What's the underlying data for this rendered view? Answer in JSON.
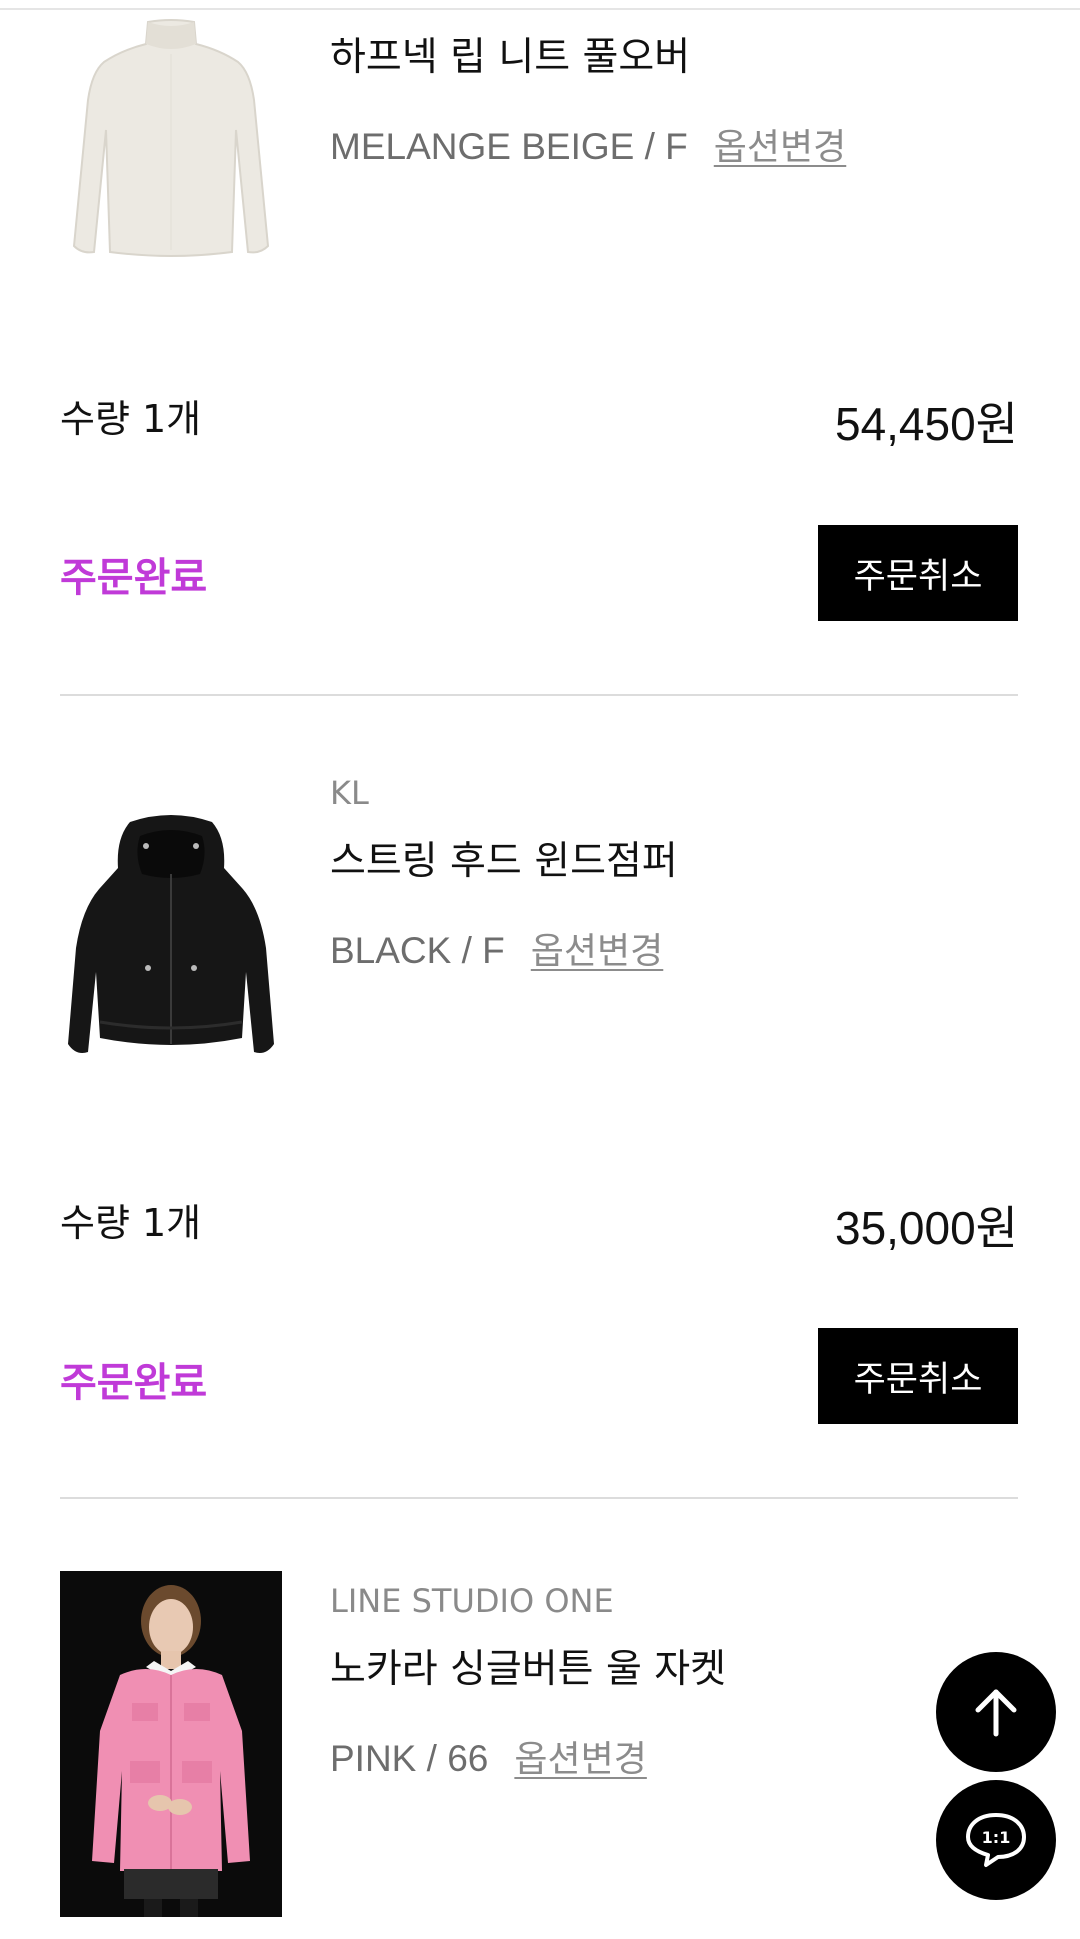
{
  "items": [
    {
      "brand": "",
      "name": "하프넥 립 니트 풀오버",
      "option": "MELANGE BEIGE / F",
      "option_change": "옵션변경",
      "quantity": "수량 1개",
      "price": "54,450원",
      "status": "주문완료",
      "cancel_label": "주문취소",
      "image": "cream-knit-sweater"
    },
    {
      "brand": "KL",
      "name": "스트링 후드 윈드점퍼",
      "option": "BLACK / F",
      "option_change": "옵션변경",
      "quantity": "수량 1개",
      "price": "35,000원",
      "status": "주문완료",
      "cancel_label": "주문취소",
      "image": "black-hooded-jacket"
    },
    {
      "brand": "LINE STUDIO ONE",
      "name": "노카라 싱글버튼 울 자켓",
      "option": "PINK / 66",
      "option_change": "옵션변경",
      "image": "pink-tweed-jacket-model"
    }
  ],
  "fabs": {
    "scroll_top_icon": "arrow-up-icon",
    "chat_label": "1:1",
    "chat_icon": "chat-bubble-icon"
  },
  "colors": {
    "status": "#c03ad8",
    "button_bg": "#000000",
    "divider": "#dcdcdc"
  }
}
